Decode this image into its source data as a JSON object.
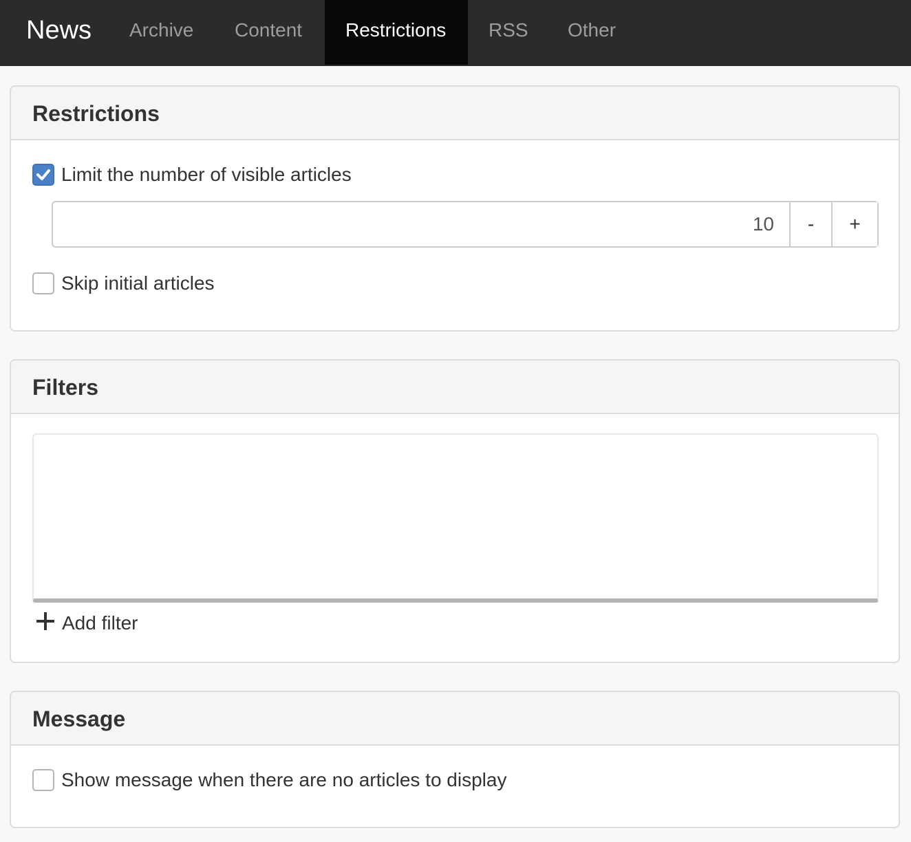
{
  "navbar": {
    "brand": "News",
    "tabs": [
      {
        "label": "Archive"
      },
      {
        "label": "Content"
      },
      {
        "label": "Restrictions",
        "active": true
      },
      {
        "label": "RSS"
      },
      {
        "label": "Other"
      }
    ]
  },
  "restrictions": {
    "title": "Restrictions",
    "limit_checkbox": {
      "label": "Limit the number of visible articles",
      "checked": true
    },
    "limit_value": "10",
    "minus_label": "-",
    "plus_label": "+",
    "skip_checkbox": {
      "label": "Skip initial articles",
      "checked": false
    }
  },
  "filters": {
    "title": "Filters",
    "add_filter_label": "Add filter"
  },
  "message": {
    "title": "Message",
    "show_message_checkbox": {
      "label": "Show message when there are no articles to display",
      "checked": false
    }
  },
  "colors": {
    "navbar_bg": "#2b2b2b",
    "active_tab_bg": "#080808",
    "checkbox_checked": "#4a80c8"
  }
}
